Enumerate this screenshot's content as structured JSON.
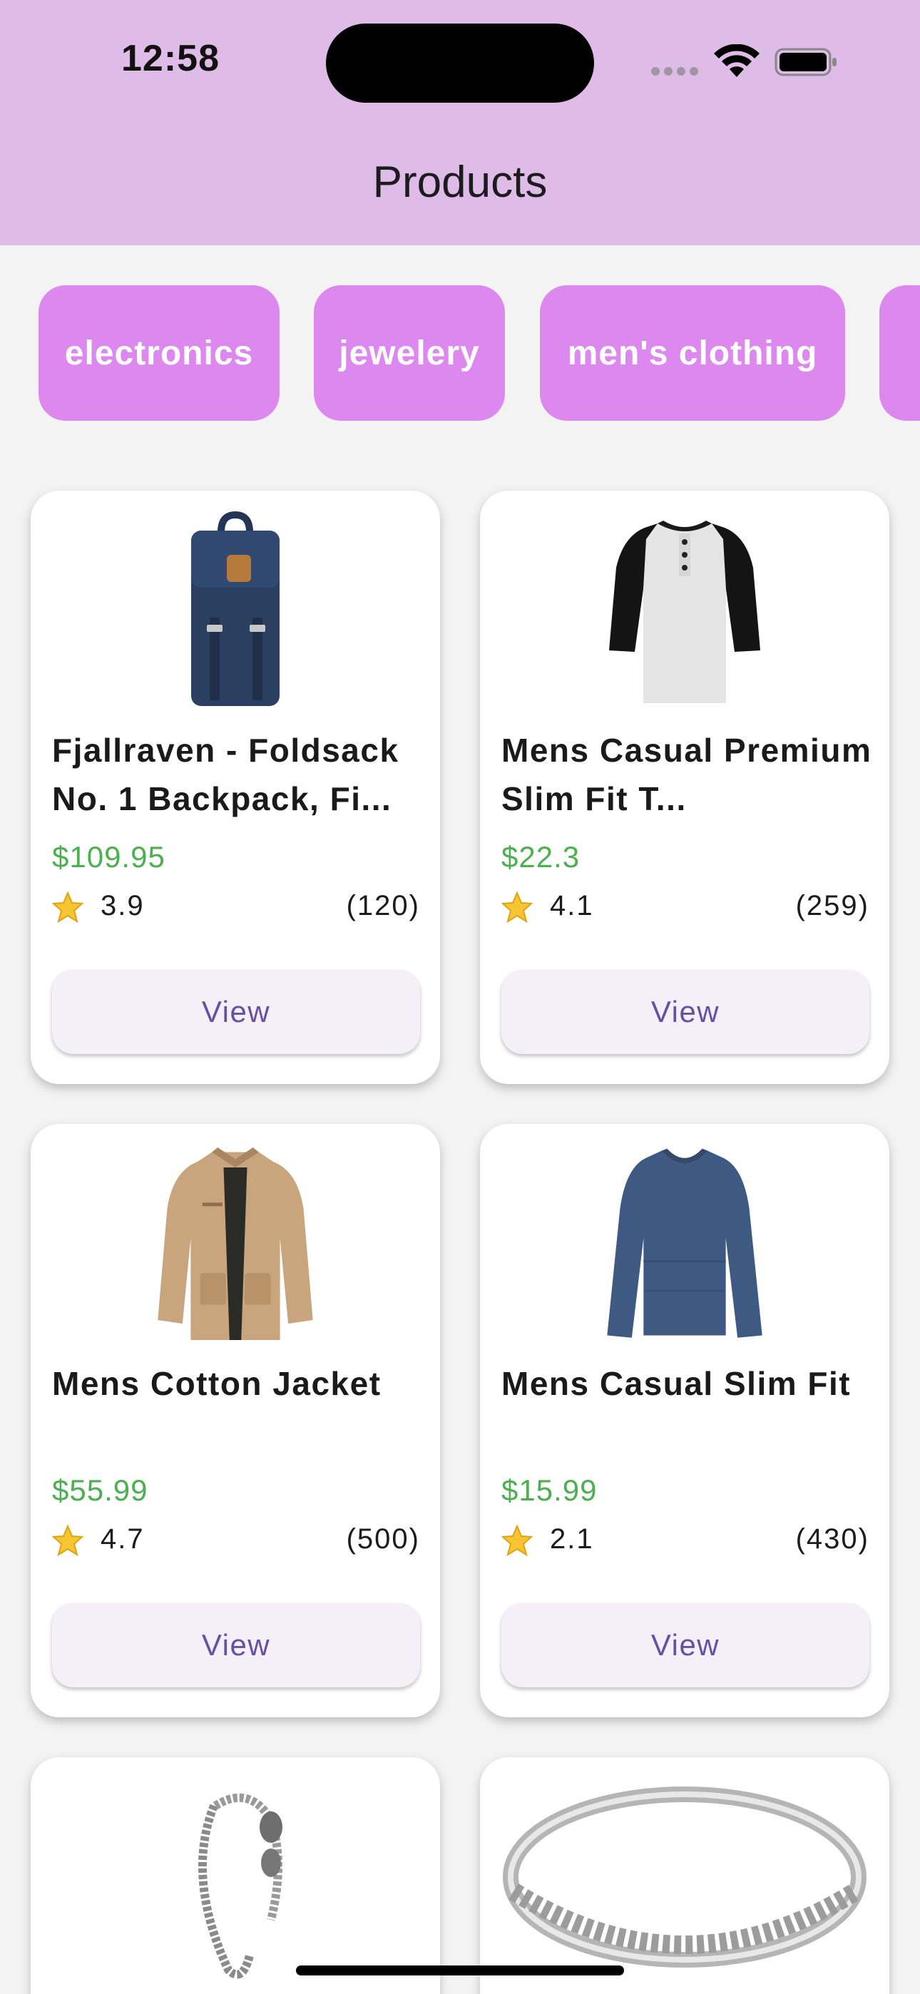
{
  "status_bar": {
    "time": "12:58"
  },
  "header": {
    "title": "Products"
  },
  "categories": [
    "electronics",
    "jewelery",
    "men's clothing",
    ""
  ],
  "products": [
    {
      "title": "Fjallraven - Foldsack No. 1 Backpack, Fi...",
      "price": "$109.95",
      "rating": "3.9",
      "count": "(120)",
      "button": "View",
      "icon": "backpack-icon"
    },
    {
      "title": "Mens Casual Premium Slim Fit T...",
      "price": "$22.3",
      "rating": "4.1",
      "count": "(259)",
      "button": "View",
      "icon": "shirt-icon"
    },
    {
      "title": "Mens Cotton Jacket",
      "price": "$55.99",
      "rating": "4.7",
      "count": "(500)",
      "button": "View",
      "icon": "jacket-icon"
    },
    {
      "title": "Mens Casual Slim Fit",
      "price": "$15.99",
      "rating": "2.1",
      "count": "(430)",
      "button": "View",
      "icon": "long-sleeve-shirt-icon"
    },
    {
      "icon": "bracelet-icon"
    },
    {
      "icon": "ring-icon"
    }
  ],
  "colors": {
    "header_bg": "#dfbbe7",
    "chip_bg": "#dd88ee",
    "price": "#4caf50",
    "button_text": "#6750a4",
    "button_bg": "#f5eff8"
  }
}
